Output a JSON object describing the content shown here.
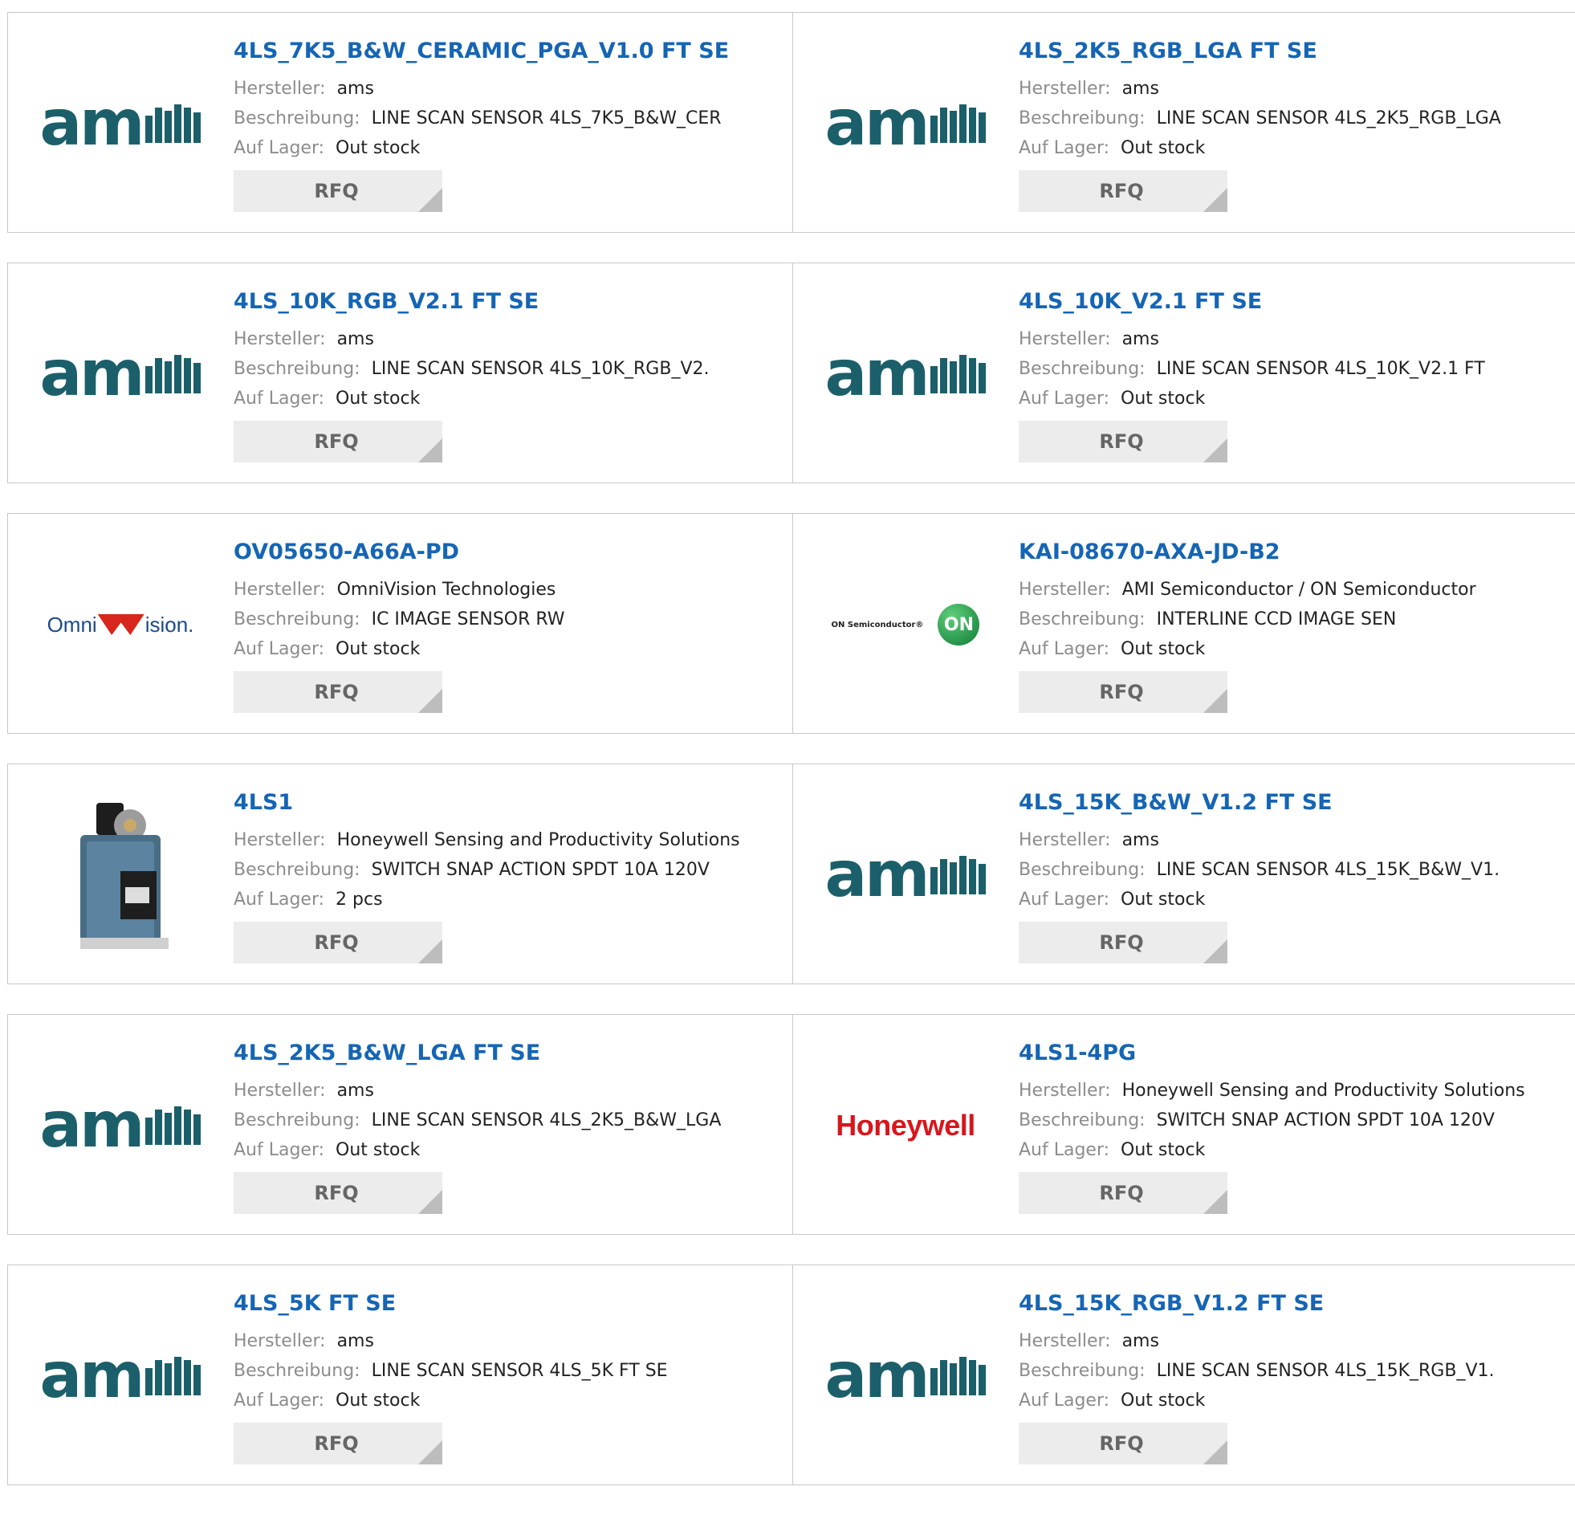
{
  "labels": {
    "manufacturer": "Hersteller:",
    "description": "Beschreibung:",
    "stock": "Auf Lager:",
    "rfq": "RFQ"
  },
  "colors": {
    "title_link": "#1565b4",
    "label": "#8c8c8c",
    "button_bg": "#ececec",
    "ams_brand": "#1b5f6a",
    "honeywell_brand": "#d8161c"
  },
  "products": [
    {
      "title": "4LS_7K5_B&W_CERAMIC_PGA_V1.0 FT SE",
      "manufacturer": "ams",
      "description": "LINE SCAN SENSOR 4LS_7K5_B&W_CER",
      "stock": "Out stock",
      "logo": "ams"
    },
    {
      "title": "4LS_2K5_RGB_LGA FT SE",
      "manufacturer": "ams",
      "description": "LINE SCAN SENSOR 4LS_2K5_RGB_LGA",
      "stock": "Out stock",
      "logo": "ams"
    },
    {
      "title": "4LS_10K_RGB_V2.1 FT SE",
      "manufacturer": "ams",
      "description": "LINE SCAN SENSOR 4LS_10K_RGB_V2.",
      "stock": "Out stock",
      "logo": "ams"
    },
    {
      "title": "4LS_10K_V2.1 FT SE",
      "manufacturer": "ams",
      "description": "LINE SCAN SENSOR 4LS_10K_V2.1 FT",
      "stock": "Out stock",
      "logo": "ams"
    },
    {
      "title": "OV05650-A66A-PD",
      "manufacturer": "OmniVision Technologies",
      "description": "IC IMAGE SENSOR RW",
      "stock": "Out stock",
      "logo": "omnivision",
      "logo_text": "Omni",
      "logo_text2": "ision."
    },
    {
      "title": "KAI-08670-AXA-JD-B2",
      "manufacturer": "AMI Semiconductor / ON Semiconductor",
      "description": "INTERLINE CCD IMAGE SEN",
      "stock": "Out stock",
      "logo": "onsemi",
      "logo_text": "ON Semiconductor®",
      "logo_text2": "ON"
    },
    {
      "title": "4LS1",
      "manufacturer": "Honeywell Sensing and Productivity Solutions",
      "description": "SWITCH SNAP ACTION SPDT 10A 120V",
      "stock": "2 pcs",
      "logo": "switch-photo"
    },
    {
      "title": "4LS_15K_B&W_V1.2 FT SE",
      "manufacturer": "ams",
      "description": "LINE SCAN SENSOR 4LS_15K_B&W_V1.",
      "stock": "Out stock",
      "logo": "ams"
    },
    {
      "title": "4LS_2K5_B&W_LGA FT SE",
      "manufacturer": "ams",
      "description": "LINE SCAN SENSOR 4LS_2K5_B&W_LGA",
      "stock": "Out stock",
      "logo": "ams"
    },
    {
      "title": "4LS1-4PG",
      "manufacturer": "Honeywell Sensing and Productivity Solutions",
      "description": "SWITCH SNAP ACTION SPDT 10A 120V",
      "stock": "Out stock",
      "logo": "honeywell",
      "logo_text": "Honeywell"
    },
    {
      "title": "4LS_5K FT SE",
      "manufacturer": "ams",
      "description": "LINE SCAN SENSOR 4LS_5K FT SE",
      "stock": "Out stock",
      "logo": "ams"
    },
    {
      "title": "4LS_15K_RGB_V1.2 FT SE",
      "manufacturer": "ams",
      "description": "LINE SCAN SENSOR 4LS_15K_RGB_V1.",
      "stock": "Out stock",
      "logo": "ams"
    }
  ]
}
